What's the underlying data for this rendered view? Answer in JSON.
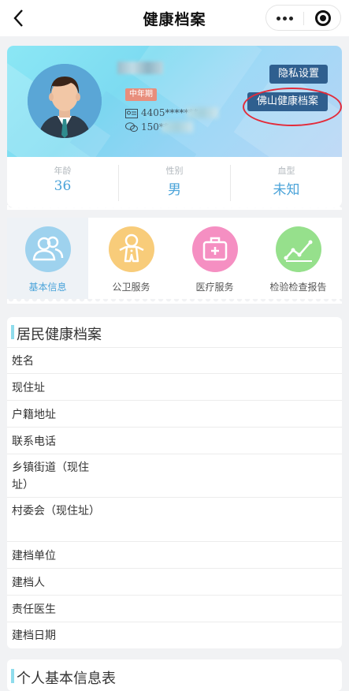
{
  "navbar": {
    "title": "健康档案",
    "back_icon": "chevron-left-icon",
    "more_icon": "more-dots-icon",
    "close_icon": "target-close-icon"
  },
  "profile": {
    "age_tag": "中年期",
    "id_number": "4405*******",
    "phone": "150**",
    "privacy_button": "隐私设置",
    "foshan_button": "佛山健康档案"
  },
  "stats": [
    {
      "label": "年龄",
      "value": "36"
    },
    {
      "label": "性别",
      "value": "男"
    },
    {
      "label": "血型",
      "value": "未知"
    }
  ],
  "menu": [
    {
      "label": "基本信息",
      "icon": "users-icon",
      "color": "#9ed2ee",
      "active": true
    },
    {
      "label": "公卫服务",
      "icon": "gingerbread-icon",
      "color": "#f8cc7a",
      "active": false
    },
    {
      "label": "医疗服务",
      "icon": "medical-kit-icon",
      "color": "#f58fc2",
      "active": false
    },
    {
      "label": "检验检查报告",
      "icon": "chart-line-icon",
      "color": "#96e08c",
      "active": false
    }
  ],
  "archive": {
    "title": "居民健康档案",
    "fields": [
      "姓名",
      "现住址",
      "户籍地址",
      "联系电话",
      "乡镇街道（现住址）",
      "村委会（现住址）",
      "建档单位",
      "建档人",
      "责任医生",
      "建档日期"
    ]
  },
  "section2": {
    "title": "个人基本信息表"
  },
  "colors": {
    "accent": "#4aa3d9",
    "tag_button": "#2f5f8f",
    "highlight": "#e32b3a"
  }
}
